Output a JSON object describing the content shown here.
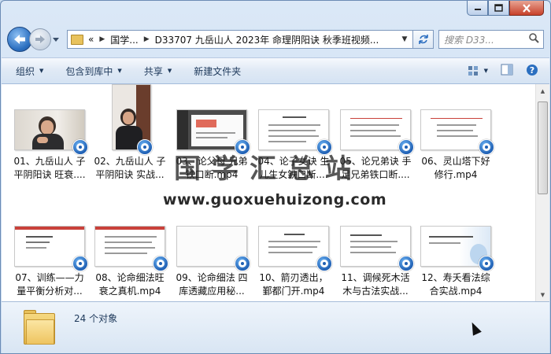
{
  "window": {
    "caption_buttons": [
      {
        "name": "minimize",
        "glyph": "▁"
      },
      {
        "name": "maximize",
        "glyph": "▢"
      },
      {
        "name": "close",
        "glyph": "✕"
      }
    ]
  },
  "nav": {
    "back_icon": "back-arrow-icon",
    "forward_icon": "forward-arrow-icon",
    "recent_icon": "chevron-down-icon"
  },
  "address": {
    "prefix": "«",
    "segments": [
      "国学...",
      "D33707 九岳山人 2023年 命理阴阳诀 秋季班视频..."
    ],
    "refresh_icon": "refresh-icon"
  },
  "search": {
    "placeholder": "搜索 D33...",
    "icon": "search-icon"
  },
  "toolbar": {
    "organize": "组织",
    "include_library": "包含到库中",
    "share": "共享",
    "new_folder": "新建文件夹",
    "view_icon": "view-options-icon",
    "preview_icon": "preview-pane-icon",
    "help_icon": "help-icon"
  },
  "files": [
    {
      "line1": "01、九岳山人 子",
      "line2": "平阴阳诀  旺衰....",
      "thumb": "person-video"
    },
    {
      "line1": "02、九岳山人 子",
      "line2": "平阴阳诀  实战...",
      "thumb": "person-portrait"
    },
    {
      "line1": "03、论父母 兄弟",
      "line2": "铁口断.mp4",
      "thumb": "dark-slide"
    },
    {
      "line1": "04、论子女诀 生",
      "line2": "儿生女铁口断....",
      "thumb": "white-slide"
    },
    {
      "line1": "05、论兄弟诀 手",
      "line2": "足兄弟铁口断....",
      "thumb": "white-slide"
    },
    {
      "line1": "06、灵山塔下好",
      "line2": "修行.mp4",
      "thumb": "white-slide"
    },
    {
      "line1": "07、训练——力",
      "line2": "量平衡分析对...",
      "thumb": "red-slide"
    },
    {
      "line1": "08、论命细法旺",
      "line2": "衰之真机.mp4",
      "thumb": "red-slide"
    },
    {
      "line1": "09、论命细法 四",
      "line2": "库透藏应用秘...",
      "thumb": "blank-slide"
    },
    {
      "line1": "10、箭刃透出，",
      "line2": "鄞都门开.mp4",
      "thumb": "white-slide"
    },
    {
      "line1": "11、调候死木活",
      "line2": "木与古法实战...",
      "thumb": "white-slide"
    },
    {
      "line1": "12、寿夭看法综",
      "line2": "合实战.mp4",
      "thumb": "blue-slide"
    }
  ],
  "watermark": {
    "title": "国学汇总站",
    "url": "www.guoxuehuizong.com"
  },
  "details": {
    "count_text": "24 个对象"
  },
  "colors": {
    "accent": "#2b6fc0",
    "slide_red": "#c9413a",
    "badge_blue": "#1f5fb3"
  }
}
